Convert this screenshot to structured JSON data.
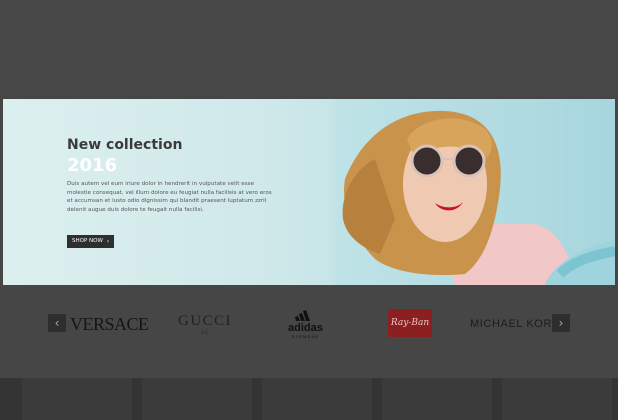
{
  "hero": {
    "title": "New collection",
    "year": "2016",
    "description": "Duis autem vel eum iriure dolor in hendrerit in vulputate velit esse molestie consequat, vel illum dolore eu feugiat nulla facilisis at vero eros et accumsan et iusto odio dignissim qui blandit praesent luptatum zzril delenit augue duis dolore te feugait nulla facilisi.",
    "button_label": "SHOP NOW",
    "button_icon": "chevron-right-icon"
  },
  "brands": {
    "prev_icon": "chevron-left-icon",
    "next_icon": "chevron-right-icon",
    "items": [
      {
        "name": "VERSACE"
      },
      {
        "name": "GUCCI"
      },
      {
        "name": "adidas",
        "sub": "EYEWEAR"
      },
      {
        "name": "Ray-Ban"
      },
      {
        "name": "MICHAEL KORS"
      }
    ]
  },
  "colors": {
    "page_bg": "#464646",
    "hero_bg": "#b7dee3",
    "button_bg": "#2f2f2f",
    "rayban_red": "#8c1f1f"
  }
}
